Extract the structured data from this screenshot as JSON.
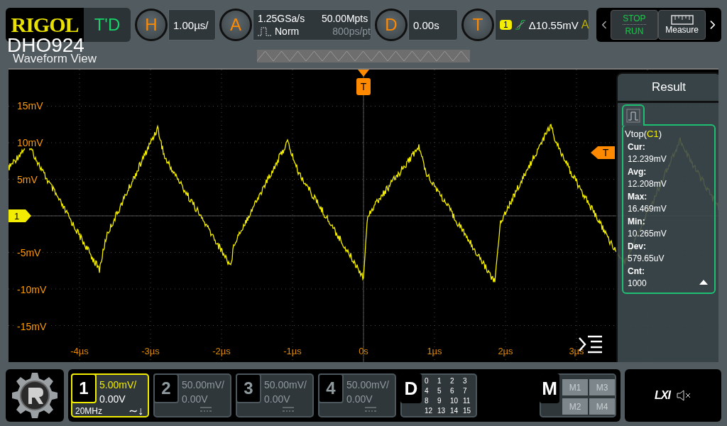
{
  "brand": {
    "logo": "RIGOL",
    "model": "DHO924"
  },
  "toolbar": {
    "mode_button": "T'D",
    "horizontal": {
      "key": "H",
      "value": "1.00µs/"
    },
    "acquisition": {
      "key": "A",
      "sample_rate": "1.25GSa/s",
      "mode": "Norm",
      "memory_depth": "50.00Mpts",
      "resolution": "800ps/pt"
    },
    "delay": {
      "key": "D",
      "value": "0.00s"
    },
    "trigger": {
      "key": "T",
      "source": "1",
      "level": "Δ10.55mV",
      "sweep": "A"
    },
    "run_stop": {
      "stop": "STOP",
      "run": "RUN"
    },
    "measure": "Measure"
  },
  "waveform_view": {
    "title": "Waveform View",
    "trigger_position_marker": "T",
    "trigger_level_marker": "T",
    "channel_marker": "1",
    "y_labels": [
      "15mV",
      "10mV",
      "5mV",
      "-5mV",
      "-10mV",
      "-15mV"
    ],
    "x_labels": [
      "-4µs",
      "-3µs",
      "-2µs",
      "-1µs",
      "0s",
      "1µs",
      "2µs",
      "3µs"
    ]
  },
  "result_panel": {
    "title": "Result",
    "measurement": {
      "name": "Vtop(",
      "source": "C1",
      "suffix": ")",
      "stats": [
        {
          "label": "Cur:",
          "value": "12.239mV"
        },
        {
          "label": "Avg:",
          "value": "12.208mV"
        },
        {
          "label": "Max:",
          "value": "16.469mV"
        },
        {
          "label": "Min:",
          "value": "10.265mV"
        },
        {
          "label": "Dev:",
          "value": "579.65uV"
        },
        {
          "label": "Cnt:",
          "value": "1000"
        }
      ]
    }
  },
  "channels": [
    {
      "number": "1",
      "scale": "5.00mV/",
      "offset": "0.00V",
      "selected": true,
      "bandwidth": "20MHz",
      "coupling": "∼↓"
    },
    {
      "number": "2",
      "scale": "50.00mV/",
      "offset": "0.00V",
      "selected": false
    },
    {
      "number": "3",
      "scale": "50.00mV/",
      "offset": "0.00V",
      "selected": false
    },
    {
      "number": "4",
      "scale": "50.00mV/",
      "offset": "0.00V",
      "selected": false
    }
  ],
  "digital": {
    "label": "D",
    "bits": [
      "0",
      "1",
      "2",
      "3",
      "4",
      "5",
      "6",
      "7",
      "8",
      "9",
      "10",
      "11",
      "12",
      "13",
      "14",
      "15"
    ]
  },
  "math": {
    "label": "M",
    "items": [
      "M1",
      "M3",
      "M2",
      "M4"
    ]
  },
  "status": {
    "lxi": "LXI"
  }
}
